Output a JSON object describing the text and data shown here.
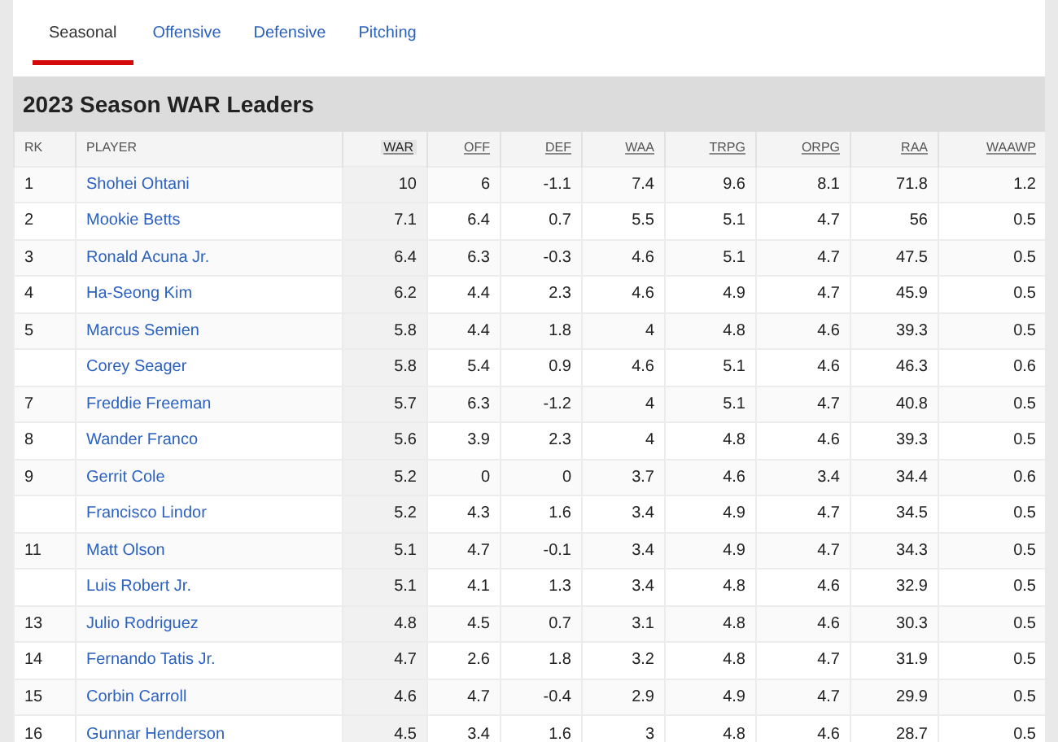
{
  "tabs": [
    {
      "label": "Seasonal",
      "selected": true
    },
    {
      "label": "Offensive",
      "selected": false
    },
    {
      "label": "Defensive",
      "selected": false
    },
    {
      "label": "Pitching",
      "selected": false
    }
  ],
  "table": {
    "title": "2023 Season WAR Leaders",
    "columns": [
      {
        "label": "RK",
        "sortable": false
      },
      {
        "label": "PLAYER",
        "sortable": false
      },
      {
        "label": "WAR",
        "sortable": true,
        "sorted": true
      },
      {
        "label": "OFF",
        "sortable": true,
        "sorted": false
      },
      {
        "label": "DEF",
        "sortable": true,
        "sorted": false
      },
      {
        "label": "WAA",
        "sortable": true,
        "sorted": false
      },
      {
        "label": "TRPG",
        "sortable": true,
        "sorted": false
      },
      {
        "label": "ORPG",
        "sortable": true,
        "sorted": false
      },
      {
        "label": "RAA",
        "sortable": true,
        "sorted": false
      },
      {
        "label": "WAAWP",
        "sortable": true,
        "sorted": false
      }
    ],
    "rows": [
      [
        "1",
        "Shohei Ohtani",
        "10",
        "6",
        "-1.1",
        "7.4",
        "9.6",
        "8.1",
        "71.8",
        "1.2"
      ],
      [
        "2",
        "Mookie Betts",
        "7.1",
        "6.4",
        "0.7",
        "5.5",
        "5.1",
        "4.7",
        "56",
        "0.5"
      ],
      [
        "3",
        "Ronald Acuna Jr.",
        "6.4",
        "6.3",
        "-0.3",
        "4.6",
        "5.1",
        "4.7",
        "47.5",
        "0.5"
      ],
      [
        "4",
        "Ha-Seong Kim",
        "6.2",
        "4.4",
        "2.3",
        "4.6",
        "4.9",
        "4.7",
        "45.9",
        "0.5"
      ],
      [
        "5",
        "Marcus Semien",
        "5.8",
        "4.4",
        "1.8",
        "4",
        "4.8",
        "4.6",
        "39.3",
        "0.5"
      ],
      [
        "",
        "Corey Seager",
        "5.8",
        "5.4",
        "0.9",
        "4.6",
        "5.1",
        "4.6",
        "46.3",
        "0.6"
      ],
      [
        "7",
        "Freddie Freeman",
        "5.7",
        "6.3",
        "-1.2",
        "4",
        "5.1",
        "4.7",
        "40.8",
        "0.5"
      ],
      [
        "8",
        "Wander Franco",
        "5.6",
        "3.9",
        "2.3",
        "4",
        "4.8",
        "4.6",
        "39.3",
        "0.5"
      ],
      [
        "9",
        "Gerrit Cole",
        "5.2",
        "0",
        "0",
        "3.7",
        "4.6",
        "3.4",
        "34.4",
        "0.6"
      ],
      [
        "",
        "Francisco Lindor",
        "5.2",
        "4.3",
        "1.6",
        "3.4",
        "4.9",
        "4.7",
        "34.5",
        "0.5"
      ],
      [
        "11",
        "Matt Olson",
        "5.1",
        "4.7",
        "-0.1",
        "3.4",
        "4.9",
        "4.7",
        "34.3",
        "0.5"
      ],
      [
        "",
        "Luis Robert Jr.",
        "5.1",
        "4.1",
        "1.3",
        "3.4",
        "4.8",
        "4.6",
        "32.9",
        "0.5"
      ],
      [
        "13",
        "Julio Rodriguez",
        "4.8",
        "4.5",
        "0.7",
        "3.1",
        "4.8",
        "4.6",
        "30.3",
        "0.5"
      ],
      [
        "14",
        "Fernando Tatis Jr.",
        "4.7",
        "2.6",
        "1.8",
        "3.2",
        "4.8",
        "4.7",
        "31.9",
        "0.5"
      ],
      [
        "15",
        "Corbin Carroll",
        "4.6",
        "4.7",
        "-0.4",
        "2.9",
        "4.9",
        "4.7",
        "29.9",
        "0.5"
      ],
      [
        "16",
        "Gunnar Henderson",
        "4.5",
        "3.4",
        "1.6",
        "3",
        "4.8",
        "4.6",
        "28.7",
        "0.5"
      ]
    ]
  }
}
